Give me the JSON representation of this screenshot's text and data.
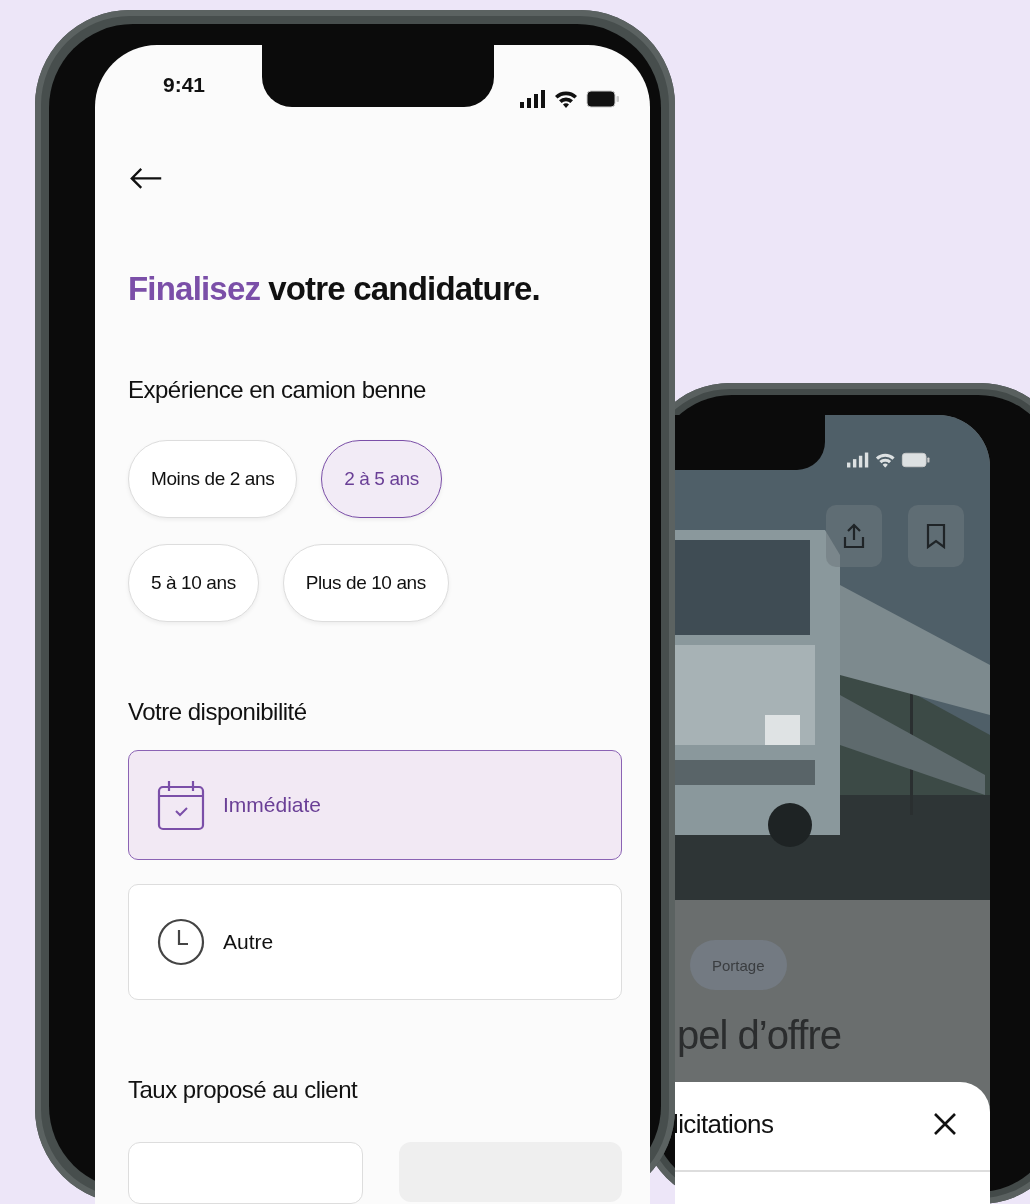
{
  "front_screen": {
    "status_bar": {
      "time": "9:41"
    },
    "title": {
      "highlight": "Finalisez",
      "rest": "votre candidature."
    },
    "experience": {
      "heading": "Expérience en camion benne",
      "options": [
        {
          "label": "Moins de 2 ans",
          "selected": false
        },
        {
          "label": "2 à 5 ans",
          "selected": true
        },
        {
          "label": "5 à 10 ans",
          "selected": false
        },
        {
          "label": "Plus de 10 ans",
          "selected": false
        }
      ]
    },
    "availability": {
      "heading": "Votre disponibilité",
      "options": [
        {
          "label": "Immédiate",
          "kind": "calendar",
          "selected": true
        },
        {
          "label": "Autre",
          "kind": "clock",
          "selected": false
        }
      ]
    },
    "rate": {
      "heading": "Taux proposé au client"
    }
  },
  "back_screen": {
    "tag": "Portage",
    "title": "pel d’offre",
    "sheet": {
      "title": "licitations"
    }
  }
}
